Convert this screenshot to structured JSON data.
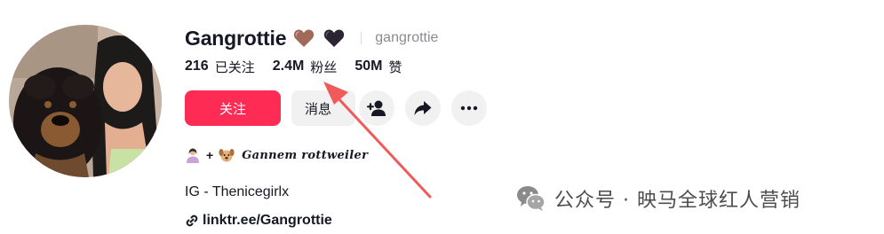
{
  "profile": {
    "display_name": "Gangrottie",
    "username": "gangrottie",
    "avatar_alt": "profile-photo"
  },
  "stats": {
    "following_count": "216",
    "following_label": "已关注",
    "followers_count": "2.4M",
    "followers_label": "粉丝",
    "likes_count": "50M",
    "likes_label": "赞"
  },
  "actions": {
    "follow_label": "关注",
    "message_label": "消息"
  },
  "bio": {
    "plus": "+",
    "tagline": "Gannem rottweiler",
    "ig": "IG - Thenicegirlx"
  },
  "link": {
    "text": "linktr.ee/Gangrottie"
  },
  "watermark": {
    "text": "公众号 · 映马全球红人营销"
  },
  "colors": {
    "accent": "#fe2c55",
    "annotation_arrow": "#f05a5a",
    "button_bg": "#f1f1f2"
  },
  "icons": [
    "brown-heart-icon",
    "black-heart-icon",
    "add-friend-icon",
    "share-icon",
    "more-icon",
    "link-icon",
    "wechat-logo-icon"
  ]
}
